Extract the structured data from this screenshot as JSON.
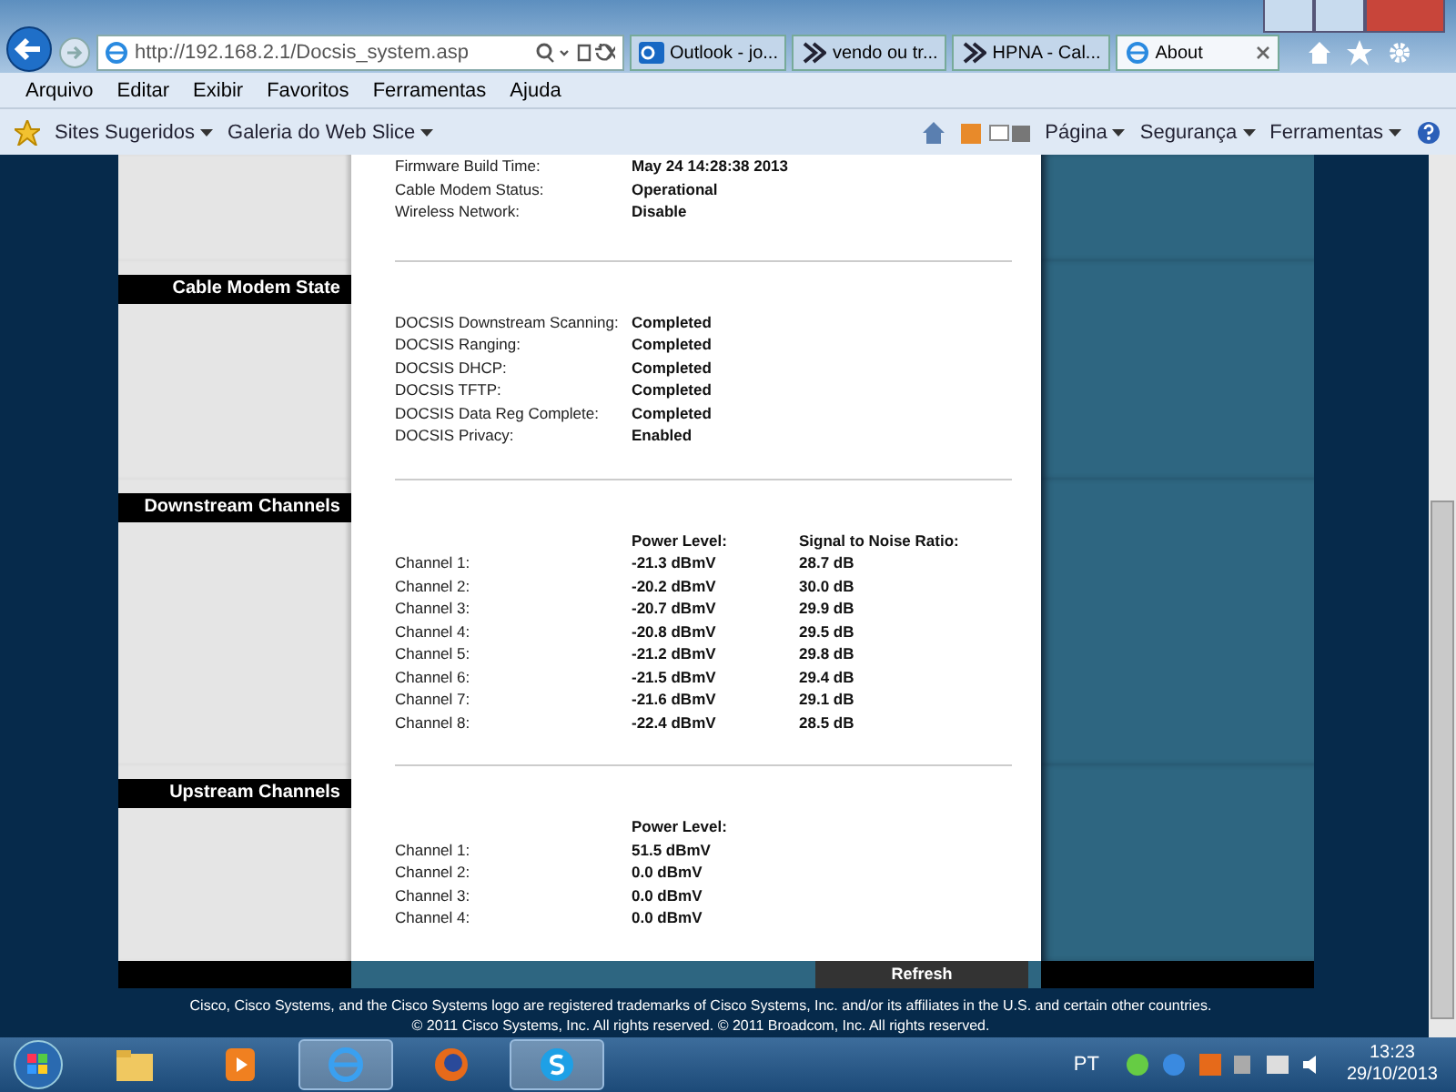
{
  "browser": {
    "address": "http://192.168.2.1/Docsis_system.asp",
    "tabs": [
      {
        "label": "Outlook - jo...",
        "kind": "outlook",
        "selected": false
      },
      {
        "label": "vendo ou tr...",
        "kind": "arrow",
        "selected": false
      },
      {
        "label": "HPNA - Cal...",
        "kind": "arrow",
        "selected": false
      },
      {
        "label": "About",
        "kind": "ie",
        "selected": true
      }
    ],
    "menu": [
      "Arquivo",
      "Editar",
      "Exibir",
      "Favoritos",
      "Ferramentas",
      "Ajuda"
    ],
    "favorites": [
      "Sites Sugeridos",
      "Galeria do Web Slice"
    ],
    "commands": [
      "Página",
      "Segurança",
      "Ferramentas"
    ]
  },
  "page": {
    "sections": [
      {
        "kind": "info",
        "rows": [
          {
            "label": "Firmware Build Time:",
            "value": "May 24 14:28:38 2013"
          },
          {
            "label": "Cable Modem Status:",
            "value": "Operational"
          },
          {
            "label": "Wireless Network:",
            "value": "Disable"
          }
        ]
      },
      {
        "kind": "info",
        "title": "Cable Modem State",
        "rows": [
          {
            "label": "DOCSIS Downstream Scanning:",
            "value": "Completed"
          },
          {
            "label": "DOCSIS Ranging:",
            "value": "Completed"
          },
          {
            "label": "DOCSIS DHCP:",
            "value": "Completed"
          },
          {
            "label": "DOCSIS TFTP:",
            "value": "Completed"
          },
          {
            "label": "DOCSIS Data Reg Complete:",
            "value": "Completed"
          },
          {
            "label": "DOCSIS Privacy:",
            "value": "Enabled"
          }
        ]
      },
      {
        "kind": "channels",
        "title": "Downstream Channels",
        "columns": [
          "Power Level:",
          "Signal to Noise Ratio:"
        ],
        "rows": [
          {
            "label": "Channel 1:",
            "values": [
              "-21.3 dBmV",
              "28.7 dB"
            ]
          },
          {
            "label": "Channel 2:",
            "values": [
              "-20.2 dBmV",
              "30.0 dB"
            ]
          },
          {
            "label": "Channel 3:",
            "values": [
              "-20.7 dBmV",
              "29.9 dB"
            ]
          },
          {
            "label": "Channel 4:",
            "values": [
              "-20.8 dBmV",
              "29.5 dB"
            ]
          },
          {
            "label": "Channel 5:",
            "values": [
              "-21.2 dBmV",
              "29.8 dB"
            ]
          },
          {
            "label": "Channel 6:",
            "values": [
              "-21.5 dBmV",
              "29.4 dB"
            ]
          },
          {
            "label": "Channel 7:",
            "values": [
              "-21.6 dBmV",
              "29.1 dB"
            ]
          },
          {
            "label": "Channel 8:",
            "values": [
              "-22.4 dBmV",
              "28.5 dB"
            ]
          }
        ]
      },
      {
        "kind": "channels",
        "title": "Upstream Channels",
        "columns": [
          "Power Level:"
        ],
        "rows": [
          {
            "label": "Channel 1:",
            "values": [
              "51.5 dBmV"
            ]
          },
          {
            "label": "Channel 2:",
            "values": [
              "0.0 dBmV"
            ]
          },
          {
            "label": "Channel 3:",
            "values": [
              "0.0 dBmV"
            ]
          },
          {
            "label": "Channel 4:",
            "values": [
              "0.0 dBmV"
            ]
          }
        ]
      }
    ],
    "refresh_button": "Refresh",
    "footer": [
      "Cisco, Cisco Systems, and the Cisco Systems logo are registered trademarks of Cisco Systems, Inc. and/or its affiliates in the U.S. and certain other countries.",
      "© 2011 Cisco Systems, Inc. All rights reserved. © 2011 Broadcom, Inc. All rights reserved."
    ]
  },
  "taskbar": {
    "apps": [
      {
        "kind": "folder",
        "selected": false
      },
      {
        "kind": "media",
        "selected": false
      },
      {
        "kind": "ie",
        "selected": true
      },
      {
        "kind": "firefox",
        "selected": false
      },
      {
        "kind": "skype",
        "selected": true
      }
    ],
    "language": "PT",
    "time": "13:23",
    "date": "29/10/2013"
  }
}
